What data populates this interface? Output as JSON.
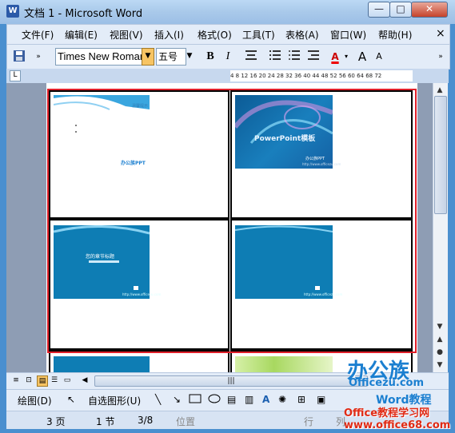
{
  "window": {
    "title": "文档 1 - Microsoft Word",
    "app_icon": "W",
    "controls": {
      "minimize": "—",
      "maximize": "□",
      "close": "✕"
    }
  },
  "menubar": {
    "items": [
      "文件(F)",
      "编辑(E)",
      "视图(V)",
      "插入(I)",
      "格式(O)",
      "工具(T)",
      "表格(A)",
      "窗口(W)",
      "帮助(H)"
    ],
    "close": "×"
  },
  "toolbar": {
    "font_name": "Times New Roman",
    "font_size": "五号",
    "bold": "B",
    "italic": "I",
    "font_color_letter": "A",
    "grow_font": "A",
    "shrink_font": "A"
  },
  "ruler": {
    "corner": "L",
    "ticks": "4  8 12 16 20 24 28 32 36 40 44 48 52 56 60 64 68 72"
  },
  "slides": [
    {
      "title": "温馨提示",
      "brand": "办公族PPT"
    },
    {
      "title": "PowerPoint模板",
      "brand": "办公族PPT",
      "url": "http://www.officezu.com"
    },
    {
      "title": "您的章节标题",
      "url": "http://www.officezu.com"
    },
    {
      "title": "",
      "url": "http://www.officezu.com"
    }
  ],
  "drawbar": {
    "draw": "绘图(D)",
    "autoshapes": "自选图形(U)"
  },
  "statusbar": {
    "page": "3 页",
    "section": "1 节",
    "page_of": "3/8",
    "position": "位置",
    "line": "行",
    "column": "列"
  },
  "watermark": {
    "brand": "办公族",
    "brand_url": "Officezu.com",
    "word_tutorial": "Word教程",
    "site": "Office教程学习网 www.office68.com"
  },
  "colors": {
    "accent": "#1b7fd0",
    "selection": "#e0202a",
    "slide_blue": "#0e7db4"
  }
}
